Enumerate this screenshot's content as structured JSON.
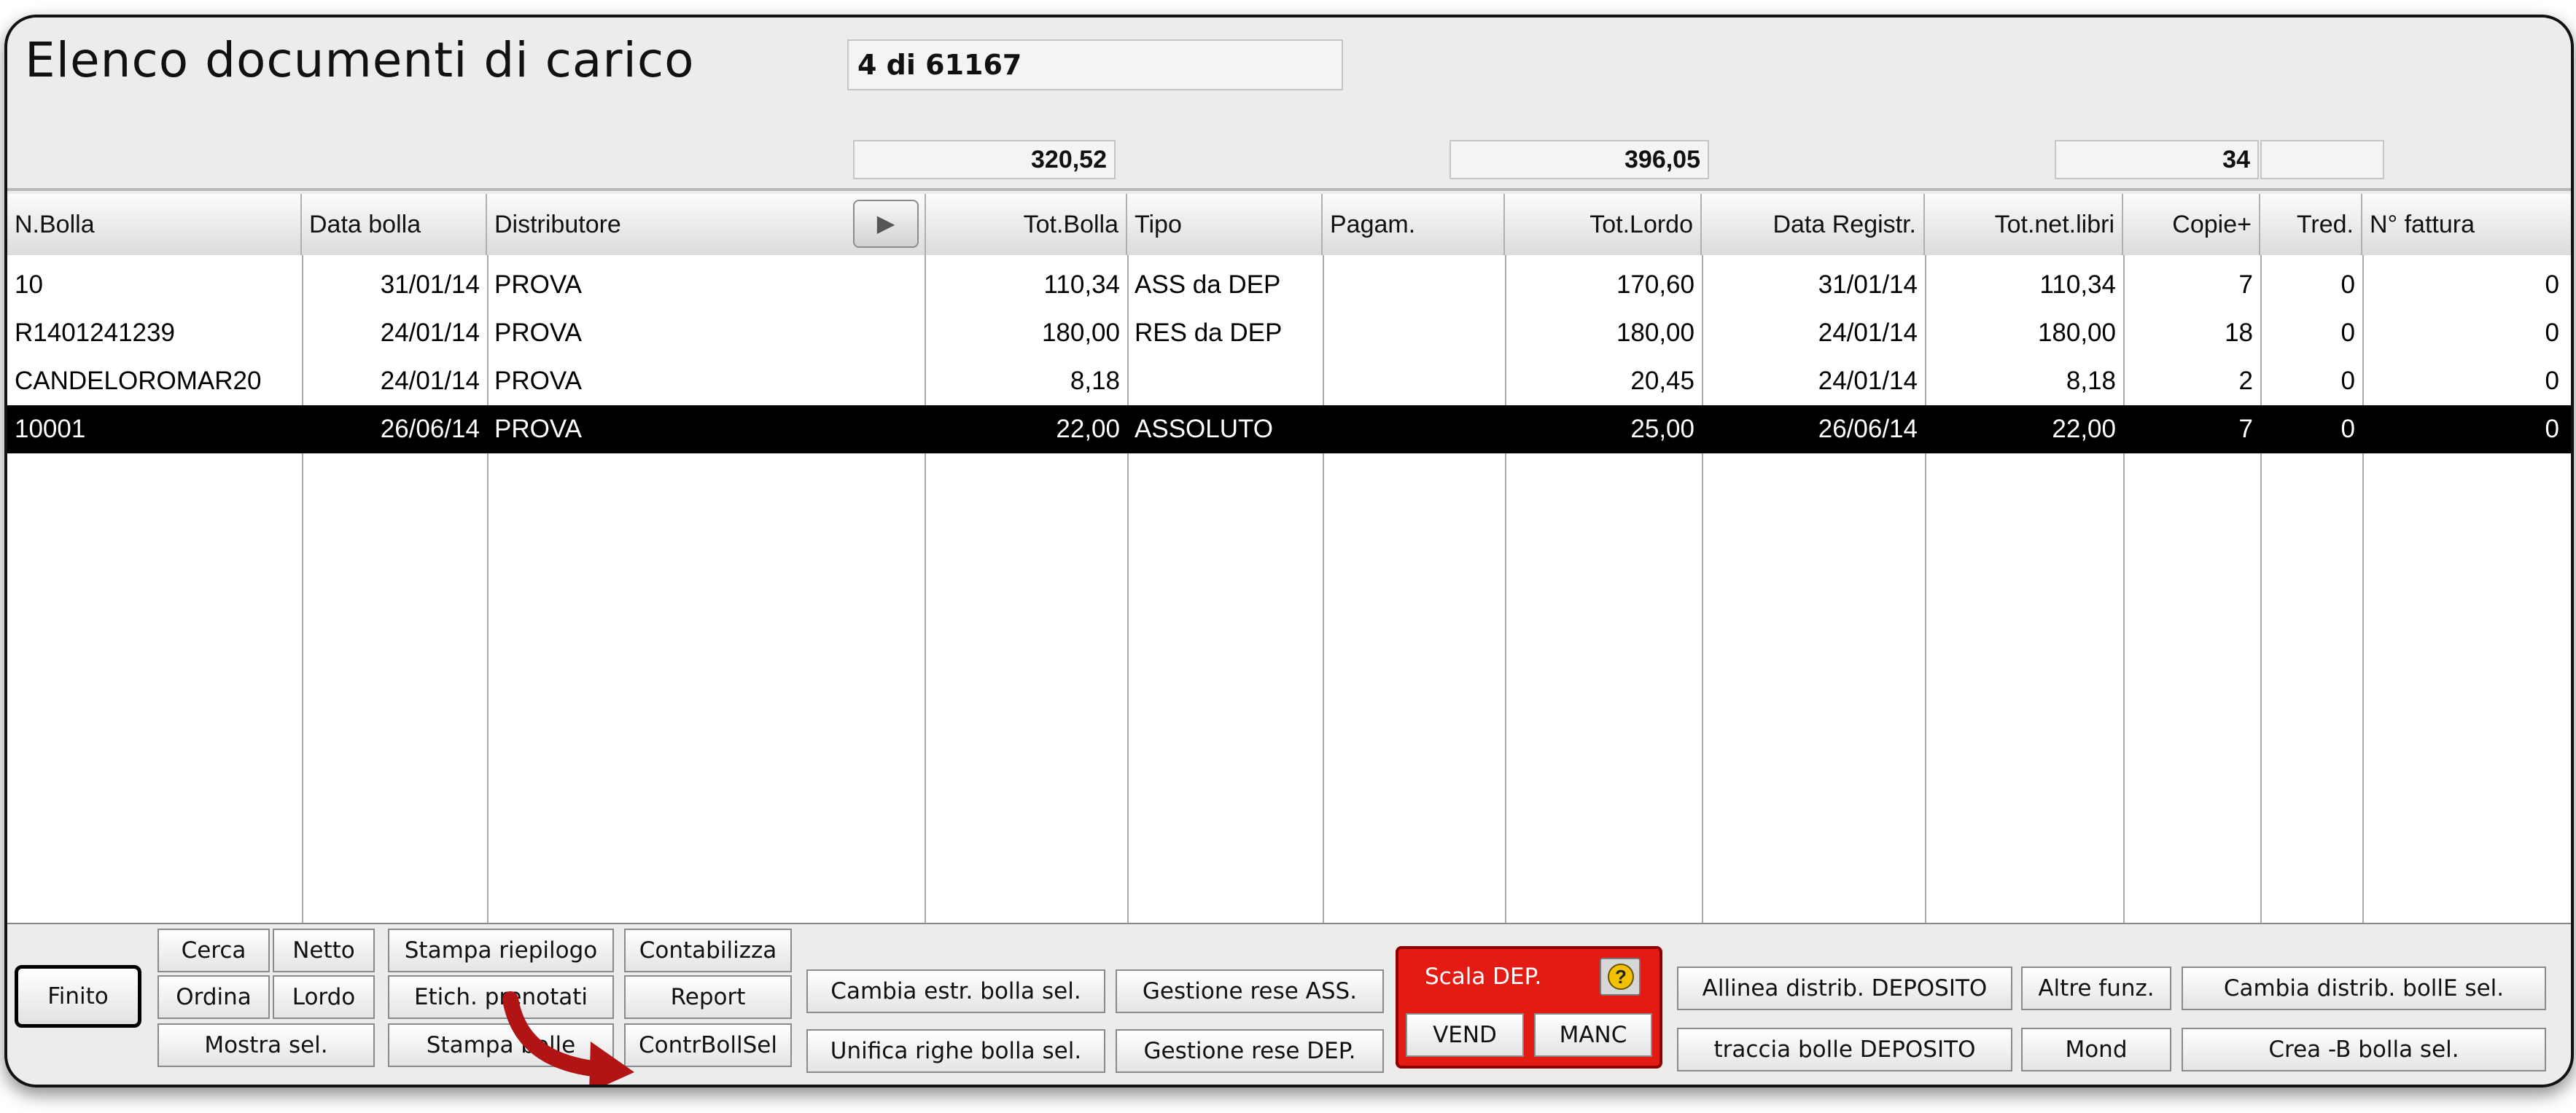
{
  "window": {
    "title": "Elenco documenti di carico",
    "record_counter": "4 di 61167"
  },
  "totals": {
    "tot_bolla": "320,52",
    "tot_lordo": "396,05",
    "copie": "34",
    "extra": ""
  },
  "table": {
    "sort_button": "▶",
    "columns": [
      "N.Bolla",
      "Data bolla",
      "Distributore",
      "Tot.Bolla",
      "Tipo",
      "Pagam.",
      "Tot.Lordo",
      "Data Registr.",
      "Tot.net.libri",
      "Copie+",
      "Tred.",
      "N° fattura"
    ],
    "rows": [
      [
        "10",
        "31/01/14",
        "PROVA",
        "110,34",
        "ASS da DEP",
        "",
        "170,60",
        "31/01/14",
        "110,34",
        "7",
        "0",
        "0"
      ],
      [
        "R1401241239",
        "24/01/14",
        "PROVA",
        "180,00",
        "RES da DEP",
        "",
        "180,00",
        "24/01/14",
        "180,00",
        "18",
        "0",
        "0"
      ],
      [
        "CANDELOROMAR20",
        "24/01/14",
        "PROVA",
        "8,18",
        "",
        "",
        "20,45",
        "24/01/14",
        "8,18",
        "2",
        "0",
        "0"
      ],
      [
        "10001",
        "26/06/14",
        "PROVA",
        "22,00",
        "ASSOLUTO",
        "",
        "25,00",
        "26/06/14",
        "22,00",
        "7",
        "0",
        "0"
      ]
    ],
    "selected_row": 3
  },
  "buttons": {
    "finito": "Finito",
    "cerca": "Cerca",
    "netto": "Netto",
    "ordina": "Ordina",
    "lordo": "Lordo",
    "mostra_sel": "Mostra sel.",
    "stampa_riepilogo": "Stampa riepilogo",
    "etich_prenotati": "Etich. prenotati",
    "stampa_bolle": "Stampa bolle",
    "contabilizza": "Contabilizza",
    "report": "Report",
    "contr_boll_sel": "ContrBollSel",
    "cambia_estr": "Cambia estr. bolla sel.",
    "unifica_righe": "Unifica righe bolla sel.",
    "gestione_rese_ass": "Gestione rese ASS.",
    "gestione_rese_dep": "Gestione rese DEP.",
    "scala_dep": "Scala DEP.",
    "vend": "VEND",
    "manc": "MANC",
    "allinea_distrib": "Allinea distrib. DEPOSITO",
    "traccia_bolle": "traccia bolle DEPOSITO",
    "altre_funz": "Altre funz.",
    "mond": "Mond",
    "cambia_distrib": "Cambia distrib. bollE sel.",
    "crea_b": "Crea -B bolla sel."
  },
  "icons": {
    "help": "help-icon",
    "sort": "play-arrow-icon",
    "annotation": "red-curved-arrow-icon"
  },
  "colors": {
    "selected_row_bg": "#000000",
    "scala_panel": "#e31b12",
    "annotation_arrow": "#b01414"
  }
}
